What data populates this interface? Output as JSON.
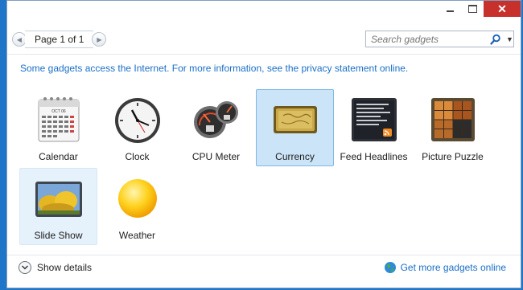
{
  "window": {
    "caption": {
      "minimize_glyph": "–",
      "maximize_glyph": "□",
      "close_glyph": "✕"
    }
  },
  "toolbar": {
    "prev_glyph": "◀",
    "next_glyph": "▶",
    "page_label": "Page 1 of 1",
    "search_placeholder": "Search gadgets",
    "search_icon": "search-icon",
    "dropdown_glyph": "▼"
  },
  "info_text": "Some gadgets access the Internet.  For more information, see the privacy statement online.",
  "gadgets": [
    {
      "label": "Calendar",
      "icon": "calendar-icon",
      "state": "normal"
    },
    {
      "label": "Clock",
      "icon": "clock-icon",
      "state": "normal"
    },
    {
      "label": "CPU Meter",
      "icon": "cpu-meter-icon",
      "state": "normal"
    },
    {
      "label": "Currency",
      "icon": "currency-icon",
      "state": "selected"
    },
    {
      "label": "Feed Headlines",
      "icon": "feed-headlines-icon",
      "state": "normal"
    },
    {
      "label": "Picture Puzzle",
      "icon": "picture-puzzle-icon",
      "state": "normal"
    },
    {
      "label": "Slide Show",
      "icon": "slide-show-icon",
      "state": "hover"
    },
    {
      "label": "Weather",
      "icon": "weather-icon",
      "state": "normal"
    }
  ],
  "calendar_icon": {
    "month": "OCT 06"
  },
  "footer": {
    "show_details": "Show details",
    "get_more": "Get more gadgets online"
  },
  "colors": {
    "link": "#1a6fc7",
    "selected_bg": "#cce4f7",
    "close_button": "#c7302b",
    "desktop": "#1f76c9"
  }
}
